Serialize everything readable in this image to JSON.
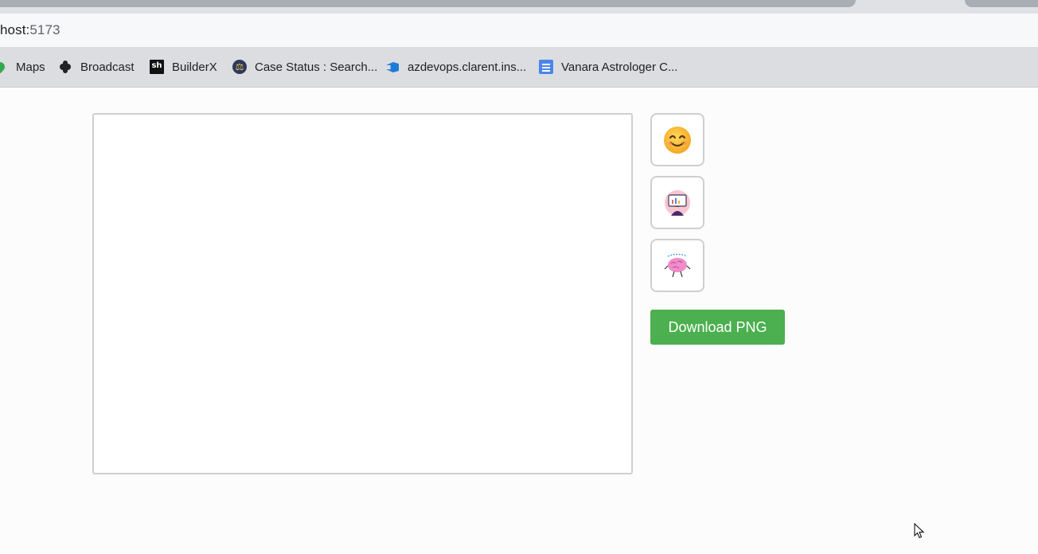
{
  "browser": {
    "url_host": "host:",
    "url_port": "5173",
    "bookmarks": [
      {
        "label": "Maps",
        "icon": "maps-pin-icon"
      },
      {
        "label": "Broadcast",
        "icon": "broadcast-icon"
      },
      {
        "label": "BuilderX",
        "icon": "sh-logo-icon",
        "icon_text": "sh"
      },
      {
        "label": "Case Status : Search...",
        "icon": "court-emblem-icon"
      },
      {
        "label": "azdevops.clarent.ins...",
        "icon": "azure-devops-icon"
      },
      {
        "label": "Vanara Astrologer C...",
        "icon": "google-docs-icon"
      }
    ]
  },
  "editor": {
    "stickers": [
      {
        "name": "smiley",
        "icon": "smiley-face-icon"
      },
      {
        "name": "laptop-person",
        "icon": "laptop-person-icon"
      },
      {
        "name": "brain",
        "icon": "brain-character-icon"
      }
    ],
    "download_label": "Download PNG"
  },
  "colors": {
    "download_button": "#4caf50",
    "canvas_border": "#cfcfcf"
  }
}
